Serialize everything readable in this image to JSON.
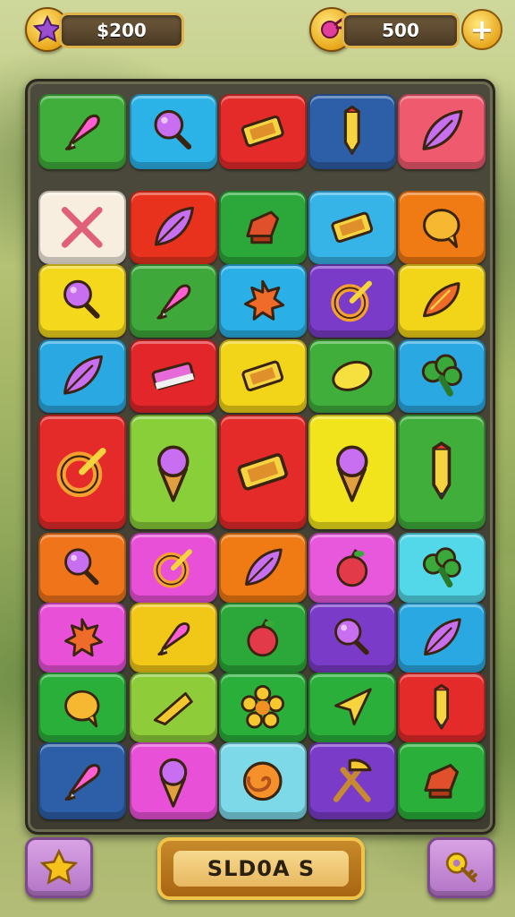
{
  "hud": {
    "left_counter": "$200",
    "left_badge_icon": "star-icon",
    "right_counter": "500",
    "right_badge_icon": "gem-icon",
    "add_button_label": "+"
  },
  "bottom_bar": {
    "main_button_label": "SLD0A S",
    "left_button_icon": "star-icon",
    "right_button_icon": "key-icon"
  },
  "board": {
    "rows": [
      [
        {
          "item": "rocket-icon",
          "color": "#3fae3a"
        },
        {
          "item": "lollipop-icon",
          "color": "#2bb3e8"
        },
        {
          "item": "candy-bar-icon",
          "color": "#e52a2a"
        },
        {
          "item": "pencil-icon",
          "color": "#2d5fa8"
        },
        {
          "item": "leaf-icon",
          "color": "#ef5a6e"
        }
      ],
      [
        {
          "item": "crossed-bones-icon",
          "color": "#f7eee0"
        },
        {
          "item": "leaf-icon",
          "color": "#e8321e"
        },
        {
          "item": "boot-icon",
          "color": "#2ca83a"
        },
        {
          "item": "candy-bar-icon",
          "color": "#36b4e8"
        },
        {
          "item": "bubble-icon",
          "color": "#f07a14"
        }
      ],
      [
        {
          "item": "lollipop-icon",
          "color": "#f4d81c"
        },
        {
          "item": "rocket-icon",
          "color": "#3ea83a"
        },
        {
          "item": "splat-icon",
          "color": "#2ab0e6"
        },
        {
          "item": "ring-icon",
          "color": "#7a3cc8"
        },
        {
          "item": "pepper-icon",
          "color": "#f2d418"
        }
      ],
      [
        {
          "item": "leaf-icon",
          "color": "#2aa8e2"
        },
        {
          "item": "eraser-icon",
          "color": "#e2262a"
        },
        {
          "item": "candy-bar-icon",
          "color": "#f2d418"
        },
        {
          "item": "lemon-icon",
          "color": "#3fae3a"
        },
        {
          "item": "broccoli-icon",
          "color": "#2aa8e2"
        }
      ],
      [
        {
          "item": "ring-icon",
          "color": "#e52a2a"
        },
        {
          "item": "ice-cream-icon",
          "color": "#88cf3a"
        },
        {
          "item": "candy-bar-icon",
          "color": "#e52a2a"
        },
        {
          "item": "ice-cream-icon",
          "color": "#f2e41c"
        },
        {
          "item": "pencil-icon",
          "color": "#3fae3a"
        }
      ],
      [
        {
          "item": "lollipop-icon",
          "color": "#f0741a"
        },
        {
          "item": "ring-icon",
          "color": "#e850d8"
        },
        {
          "item": "leaf-icon",
          "color": "#f07a14"
        },
        {
          "item": "apple-icon",
          "color": "#e858dc"
        },
        {
          "item": "broccoli-icon",
          "color": "#52d8e8"
        }
      ],
      [
        {
          "item": "splat-icon",
          "color": "#e850d8"
        },
        {
          "item": "rocket-icon",
          "color": "#f2c818"
        },
        {
          "item": "apple-icon",
          "color": "#2ca83a"
        },
        {
          "item": "lollipop-icon",
          "color": "#7a3cc8"
        },
        {
          "item": "leaf-icon",
          "color": "#2aa8e2"
        }
      ],
      [
        {
          "item": "bubble-icon",
          "color": "#2ab03a"
        },
        {
          "item": "cheese-icon",
          "color": "#8fcc3a"
        },
        {
          "item": "flower-icon",
          "color": "#2ab03a"
        },
        {
          "item": "arrow-icon",
          "color": "#2ab03a"
        },
        {
          "item": "pencil-icon",
          "color": "#e52a2a"
        }
      ],
      [
        {
          "item": "rocket-icon",
          "color": "#2d5fa8"
        },
        {
          "item": "ice-cream-icon",
          "color": "#e850d8"
        },
        {
          "item": "swirl-icon",
          "color": "#7dd8e8"
        },
        {
          "item": "hammer-icon",
          "color": "#7a3cc8"
        },
        {
          "item": "boot-icon",
          "color": "#2ab03a"
        }
      ]
    ]
  }
}
